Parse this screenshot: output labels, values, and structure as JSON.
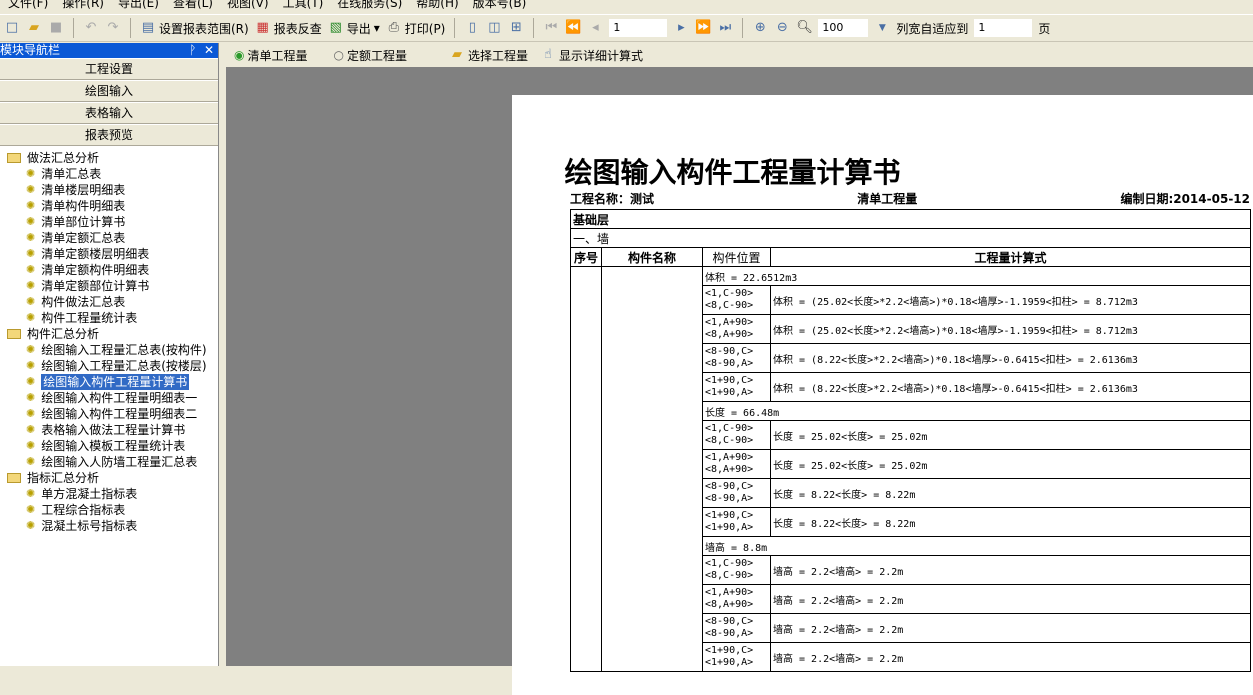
{
  "menu": [
    "文件(F)",
    "操作(R)",
    "导出(E)",
    "查看(L)",
    "视图(V)",
    "工具(T)",
    "在线服务(S)",
    "帮助(H)",
    "版本号(B)"
  ],
  "toolbar": {
    "set_range": "设置报表范围(R)",
    "reverse_check": "报表反查",
    "export": "导出",
    "print": "打印(P)",
    "page": "1",
    "zoom": "100",
    "fit_label": "列宽自适应到",
    "fit_pages": "1",
    "page_unit": "页"
  },
  "nav": {
    "title": "模块导航栏",
    "buttons": [
      "工程设置",
      "绘图输入",
      "表格输入",
      "报表预览"
    ],
    "groups": [
      {
        "label": "做法汇总分析",
        "items": [
          "清单汇总表",
          "清单楼层明细表",
          "清单构件明细表",
          "清单部位计算书",
          "清单定额汇总表",
          "清单定额楼层明细表",
          "清单定额构件明细表",
          "清单定额部位计算书",
          "构件做法汇总表",
          "构件工程量统计表"
        ]
      },
      {
        "label": "构件汇总分析",
        "items": [
          "绘图输入工程量汇总表(按构件)",
          "绘图输入工程量汇总表(按楼层)",
          "绘图输入构件工程量计算书",
          "绘图输入构件工程量明细表一",
          "绘图输入构件工程量明细表二",
          "表格输入做法工程量计算书",
          "绘图输入模板工程量统计表",
          "绘图输入人防墙工程量汇总表"
        ]
      },
      {
        "label": "指标汇总分析",
        "items": [
          "单方混凝土指标表",
          "工程综合指标表",
          "混凝土标号指标表"
        ]
      }
    ],
    "selected": "绘图输入构件工程量计算书"
  },
  "subbar": {
    "opt1": "清单工程量",
    "opt2": "定额工程量",
    "choose": "选择工程量",
    "detail": "显示详细计算式"
  },
  "report": {
    "title": "绘图输入构件工程量计算书",
    "project": "工程名称：测试",
    "type": "清单工程量",
    "date": "编制日期:2014-05-12",
    "floor": "基础层",
    "category": "一、墙",
    "headers": [
      "序号",
      "构件名称",
      "构件位置",
      "工程量计算式"
    ],
    "sections": [
      {
        "total": "体积 = 22.6512m3",
        "rows": [
          [
            "<1,C-90><8,C-90>",
            "体积 = (25.02<长度>*2.2<墙高>)*0.18<墙厚>-1.1959<扣柱> = 8.712m3"
          ],
          [
            "<1,A+90><8,A+90>",
            "体积 = (25.02<长度>*2.2<墙高>)*0.18<墙厚>-1.1959<扣柱> = 8.712m3"
          ],
          [
            "<8-90,C><8-90,A>",
            "体积 = (8.22<长度>*2.2<墙高>)*0.18<墙厚>-0.6415<扣柱> = 2.6136m3"
          ],
          [
            "<1+90,C><1+90,A>",
            "体积 = (8.22<长度>*2.2<墙高>)*0.18<墙厚>-0.6415<扣柱> = 2.6136m3"
          ]
        ]
      },
      {
        "total": "长度 = 66.48m",
        "rows": [
          [
            "<1,C-90><8,C-90>",
            "长度 = 25.02<长度> = 25.02m"
          ],
          [
            "<1,A+90><8,A+90>",
            "长度 = 25.02<长度> = 25.02m"
          ],
          [
            "<8-90,C><8-90,A>",
            "长度 = 8.22<长度> = 8.22m"
          ],
          [
            "<1+90,C><1+90,A>",
            "长度 = 8.22<长度> = 8.22m"
          ]
        ]
      },
      {
        "total": "墙高 = 8.8m",
        "rows": [
          [
            "<1,C-90><8,C-90>",
            "墙高 = 2.2<墙高> = 2.2m"
          ],
          [
            "<1,A+90><8,A+90>",
            "墙高 = 2.2<墙高> = 2.2m"
          ],
          [
            "<8-90,C><8-90,A>",
            "墙高 = 2.2<墙高> = 2.2m"
          ],
          [
            "<1+90,C><1+90,A>",
            "墙高 = 2.2<墙高> = 2.2m"
          ]
        ]
      }
    ]
  }
}
